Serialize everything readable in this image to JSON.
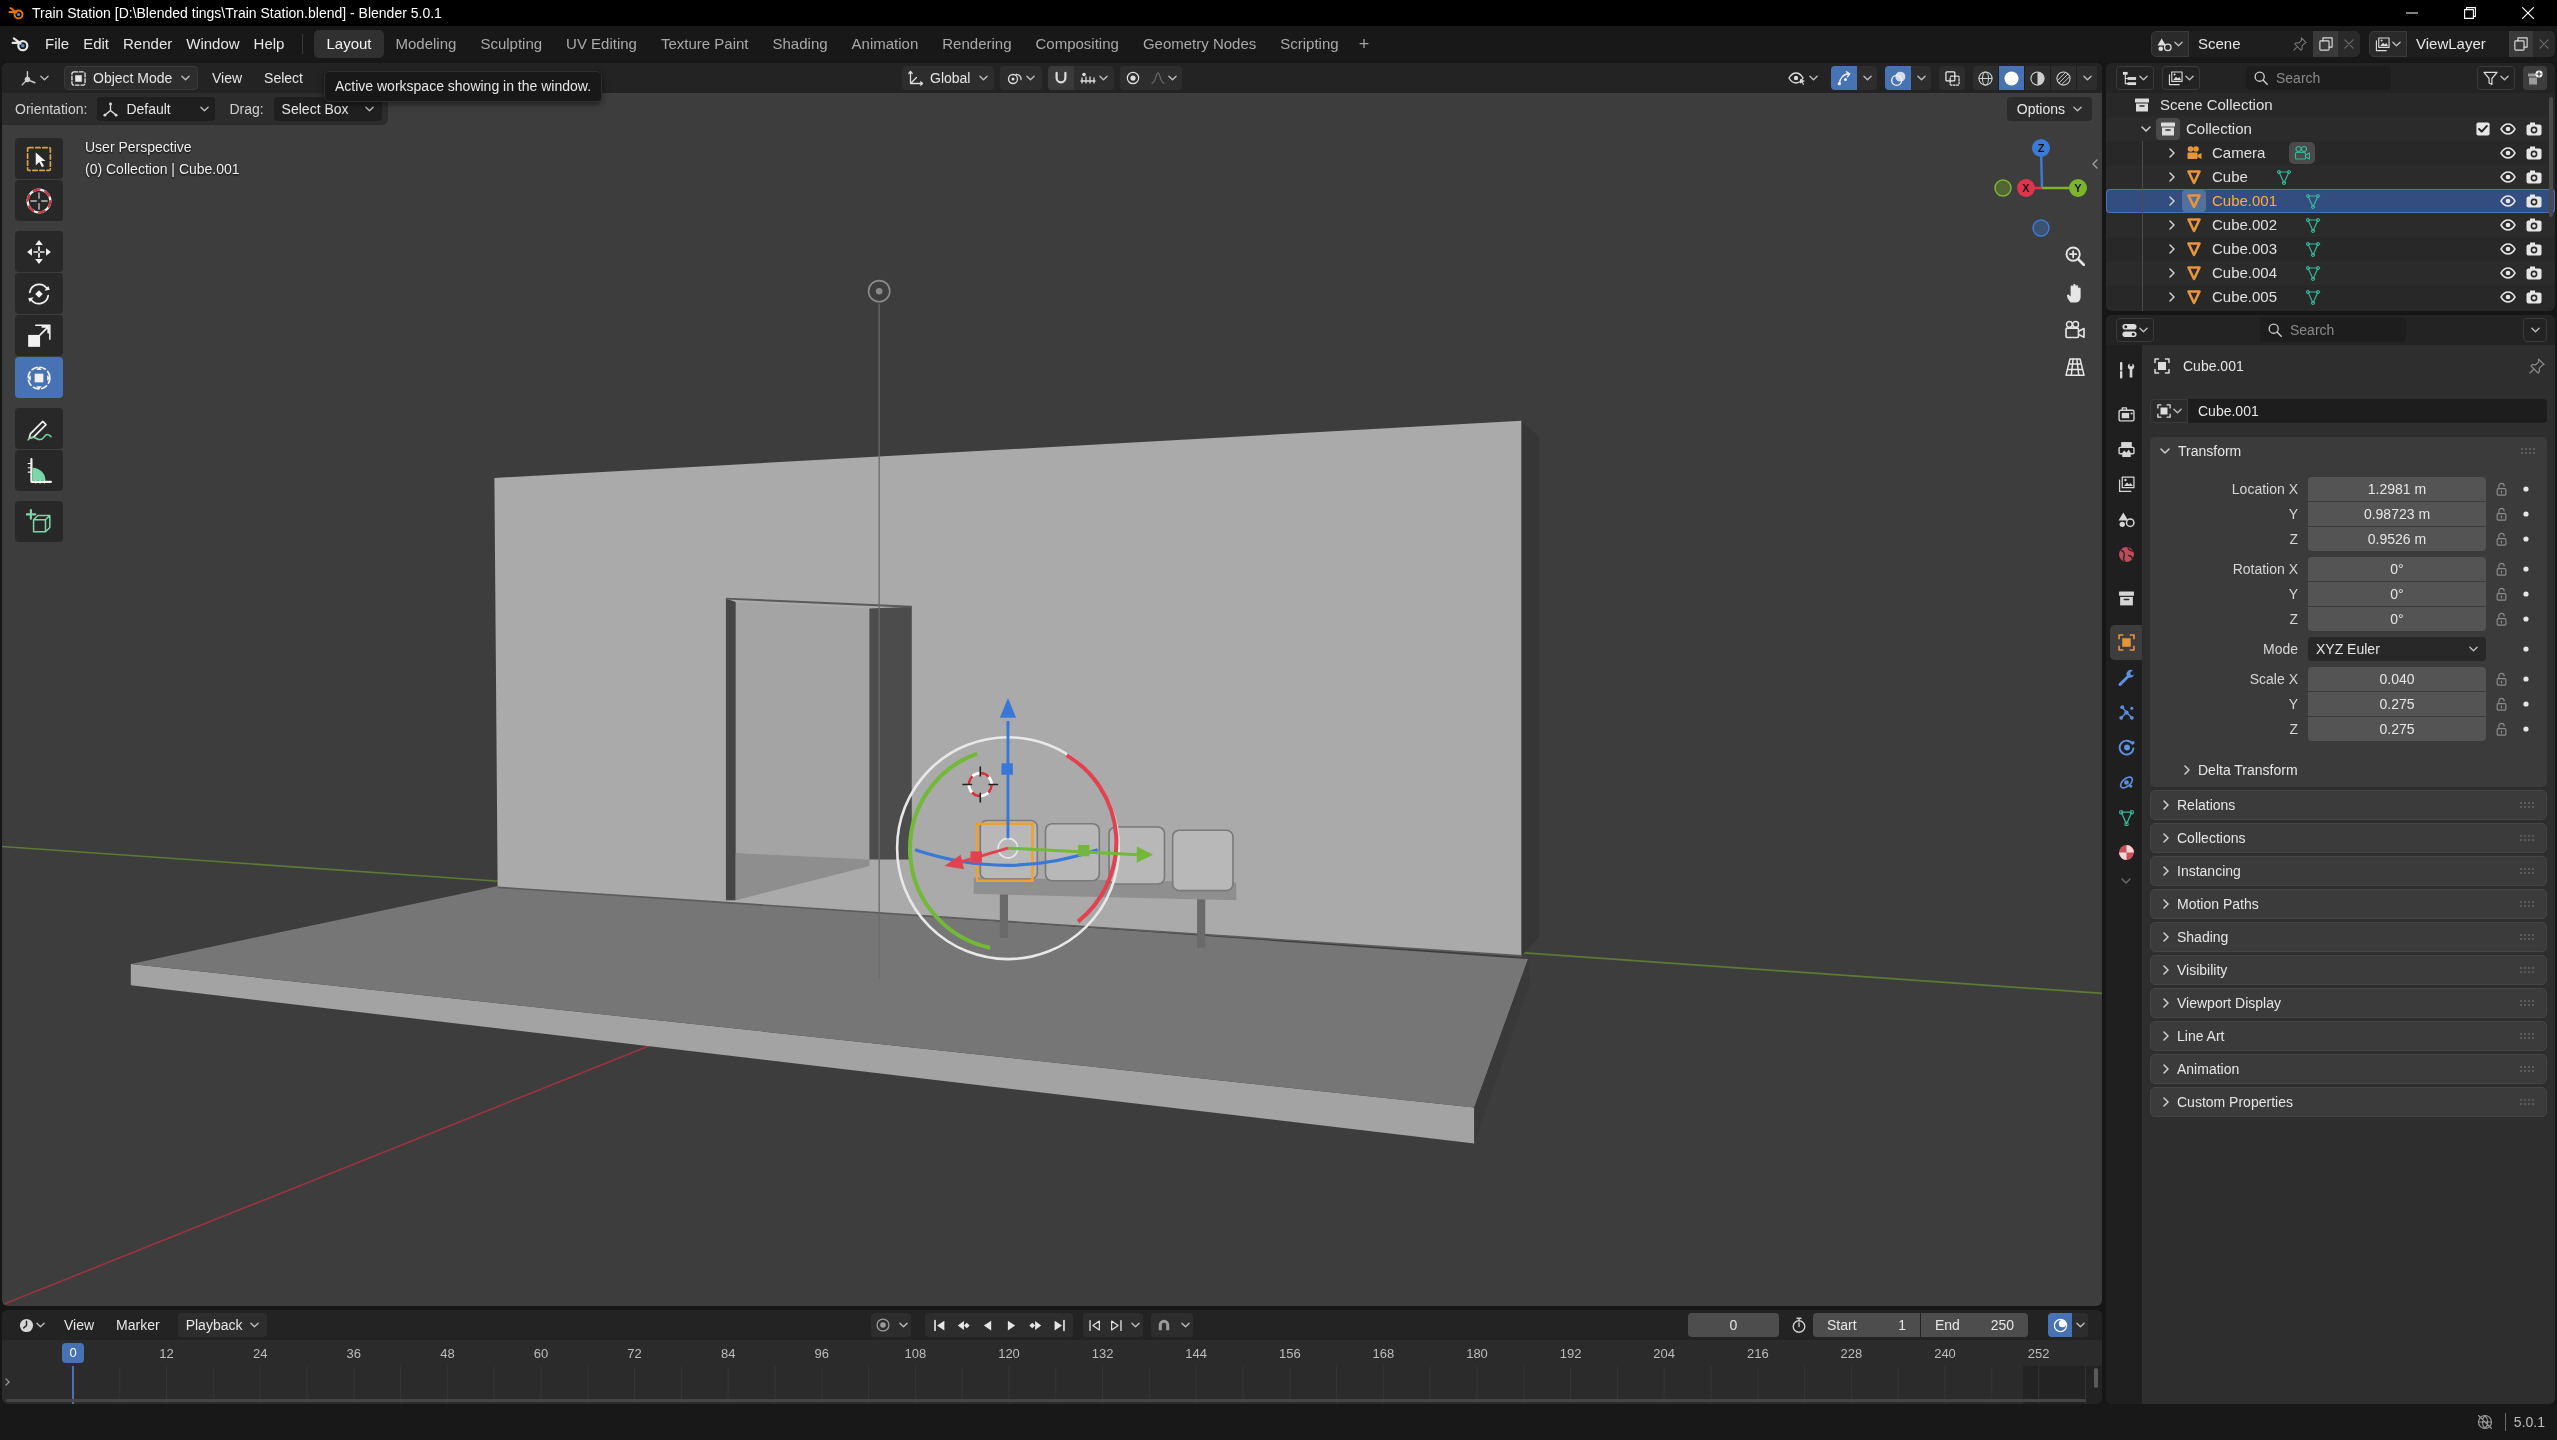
{
  "title_bar": {
    "title": "Train Station [D:\\Blended tings\\Train Station.blend] - Blender 5.0.1"
  },
  "top_bar": {
    "menus": [
      "File",
      "Edit",
      "Render",
      "Window",
      "Help"
    ],
    "workspaces": [
      {
        "label": "Layout",
        "selected": true
      },
      {
        "label": "Modeling",
        "selected": false
      },
      {
        "label": "Sculpting",
        "selected": false
      },
      {
        "label": "UV Editing",
        "selected": false
      },
      {
        "label": "Texture Paint",
        "selected": false
      },
      {
        "label": "Shading",
        "selected": false
      },
      {
        "label": "Animation",
        "selected": false
      },
      {
        "label": "Rendering",
        "selected": false
      },
      {
        "label": "Compositing",
        "selected": false
      },
      {
        "label": "Geometry Nodes",
        "selected": false
      },
      {
        "label": "Scripting",
        "selected": false
      }
    ],
    "add_workspace": "+",
    "scene": "Scene",
    "view_layer": "ViewLayer"
  },
  "viewport": {
    "header": {
      "mode": "Object Mode",
      "menus": [
        "View",
        "Select"
      ],
      "orientation": "Global",
      "toggles": [
        {
          "kind": "gizmo",
          "on": true
        },
        {
          "kind": "overlay",
          "on": true
        },
        {
          "kind": "xray",
          "on": false
        }
      ],
      "shading": [
        {
          "kind": "wireframe",
          "selected": false
        },
        {
          "kind": "solid",
          "selected": true
        },
        {
          "kind": "material",
          "selected": false
        },
        {
          "kind": "rendered",
          "selected": false
        }
      ]
    },
    "tooltip": "Active workspace showing in the window.",
    "tool_settings": {
      "orientation_label": "Orientation:",
      "orientation": "Default",
      "drag_label": "Drag:",
      "drag": "Select Box",
      "options": "Options"
    },
    "toolbar": [
      {
        "kind": "select_box",
        "selected": false
      },
      {
        "kind": "cursor",
        "selected": false
      },
      {
        "kind": "move",
        "selected": false
      },
      {
        "kind": "rotate",
        "selected": false
      },
      {
        "kind": "scale",
        "selected": false
      },
      {
        "kind": "transform",
        "selected": true
      },
      {
        "kind": "annotate",
        "selected": false
      },
      {
        "kind": "measure",
        "selected": false
      },
      {
        "kind": "add_cube",
        "selected": false
      }
    ],
    "view_name": "User Perspective",
    "context": "(0) Collection | Cube.001",
    "nav_gizmo": [
      {
        "label": "Z",
        "color": "#3b7bd6"
      },
      {
        "label": "X",
        "color": "#e2334d"
      },
      {
        "label": "Y",
        "color": "#7cb52c"
      }
    ]
  },
  "timeline": {
    "menus": [
      "View",
      "Marker"
    ],
    "playback": "Playback",
    "current_frame": "0",
    "start_label": "Start",
    "start": "1",
    "end_label": "End",
    "end": "250",
    "playhead": "0",
    "ruler": [
      "12",
      "24",
      "36",
      "48",
      "60",
      "72",
      "84",
      "96",
      "108",
      "120",
      "132",
      "144",
      "156",
      "168",
      "180",
      "192",
      "204",
      "216",
      "228",
      "240",
      "252"
    ]
  },
  "outliner": {
    "search": {
      "placeholder": "Search"
    },
    "tree": [
      {
        "label": "Scene Collection",
        "kind": "scene_collection",
        "selected": false,
        "children": [
          {
            "label": "Collection",
            "kind": "collection",
            "expanded": true,
            "checked": true,
            "selected": false,
            "children": [
              {
                "label": "Camera",
                "kind": "camera",
                "expanded": false,
                "selected": false
              },
              {
                "label": "Cube",
                "kind": "mesh",
                "expanded": false,
                "selected": false
              },
              {
                "label": "Cube.001",
                "kind": "mesh",
                "expanded": false,
                "selected": true
              },
              {
                "label": "Cube.002",
                "kind": "mesh",
                "expanded": false,
                "selected": false
              },
              {
                "label": "Cube.003",
                "kind": "mesh",
                "expanded": false,
                "selected": false
              },
              {
                "label": "Cube.004",
                "kind": "mesh",
                "expanded": false,
                "selected": false
              },
              {
                "label": "Cube.005",
                "kind": "mesh",
                "expanded": false,
                "selected": false
              }
            ]
          }
        ]
      }
    ]
  },
  "properties": {
    "search": {
      "placeholder": "Search"
    },
    "tabs": [
      {
        "kind": "tool",
        "selected": false
      },
      {
        "kind": "render",
        "selected": false
      },
      {
        "kind": "output",
        "selected": false
      },
      {
        "kind": "view_layer",
        "selected": false
      },
      {
        "kind": "scene",
        "selected": false
      },
      {
        "kind": "world",
        "selected": false
      },
      {
        "kind": "collection",
        "selected": false
      },
      {
        "kind": "object",
        "selected": true
      },
      {
        "kind": "modifiers",
        "selected": false
      },
      {
        "kind": "particles",
        "selected": false
      },
      {
        "kind": "physics",
        "selected": false
      },
      {
        "kind": "constraints",
        "selected": false
      },
      {
        "kind": "data",
        "selected": false
      },
      {
        "kind": "material",
        "selected": false
      }
    ],
    "object_name": "Cube.001",
    "datablock": "Cube.001",
    "transform": {
      "title": "Transform",
      "expanded": true,
      "groups": [
        {
          "rows": [
            {
              "label": "Location X",
              "value": "1.2981 m",
              "kind": "number"
            },
            {
              "label": "Y",
              "value": "0.98723 m",
              "kind": "number"
            },
            {
              "label": "Z",
              "value": "0.9526 m",
              "kind": "number"
            }
          ]
        },
        {
          "rows": [
            {
              "label": "Rotation X",
              "value": "0°",
              "kind": "number"
            },
            {
              "label": "Y",
              "value": "0°",
              "kind": "number"
            },
            {
              "label": "Z",
              "value": "0°",
              "kind": "number"
            }
          ]
        },
        {
          "rows": [
            {
              "label": "Mode",
              "value": "XYZ Euler",
              "kind": "dropdown"
            }
          ]
        },
        {
          "rows": [
            {
              "label": "Scale X",
              "value": "0.040",
              "kind": "number"
            },
            {
              "label": "Y",
              "value": "0.275",
              "kind": "number"
            },
            {
              "label": "Z",
              "value": "0.275",
              "kind": "number"
            }
          ]
        }
      ],
      "delta": {
        "title": "Delta Transform",
        "expanded": false
      }
    },
    "panels": [
      {
        "title": "Relations",
        "expanded": false
      },
      {
        "title": "Collections",
        "expanded": false
      },
      {
        "title": "Instancing",
        "expanded": false
      },
      {
        "title": "Motion Paths",
        "expanded": false
      },
      {
        "title": "Shading",
        "expanded": false
      },
      {
        "title": "Visibility",
        "expanded": false
      },
      {
        "title": "Viewport Display",
        "expanded": false
      },
      {
        "title": "Line Art",
        "expanded": false
      },
      {
        "title": "Animation",
        "expanded": false
      },
      {
        "title": "Custom Properties",
        "expanded": false
      }
    ]
  },
  "status_bar": {
    "version": "5.0.1"
  }
}
